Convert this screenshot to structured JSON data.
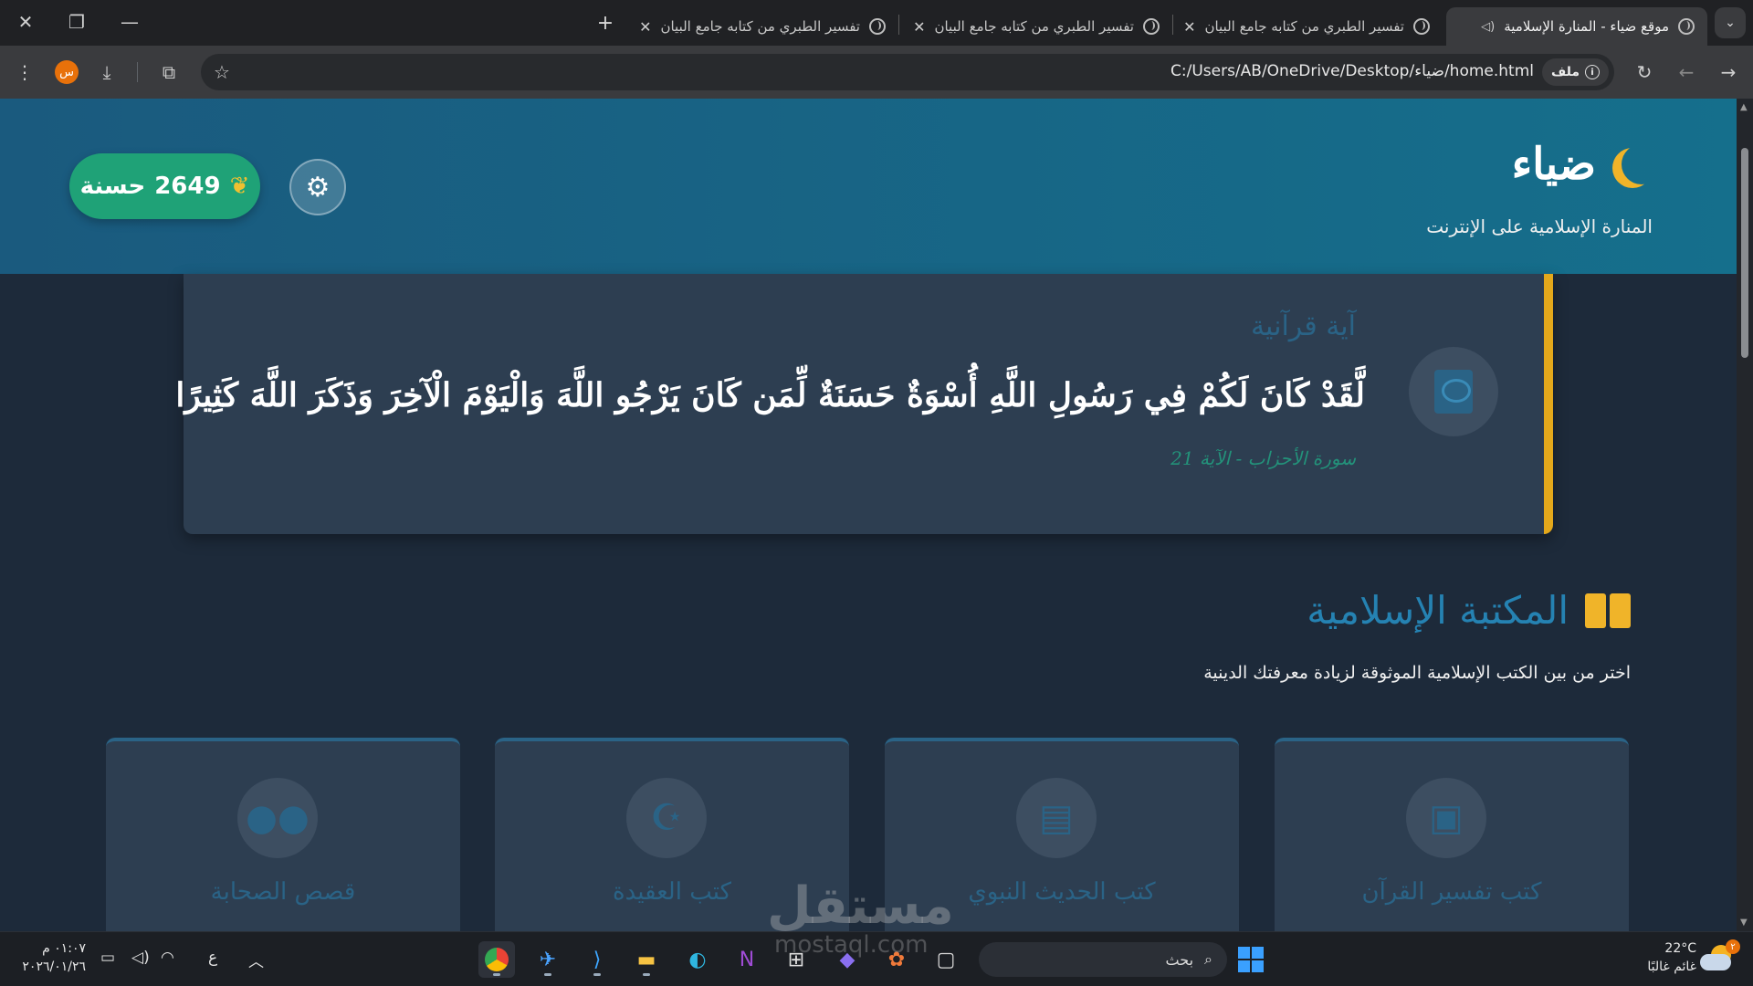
{
  "browser": {
    "tabs": [
      {
        "title": "موقع ضياء - المنارة الإسلامية",
        "active": true
      },
      {
        "title": "تفسير الطبري من كتابه جامع البيان",
        "active": false
      },
      {
        "title": "تفسير الطبري من كتابه جامع البيان",
        "active": false
      },
      {
        "title": "تفسير الطبري من كتابه جامع البيان",
        "active": false
      }
    ],
    "new_tab": "+",
    "address": {
      "chip_label": "ملف",
      "url": "C:/Users/AB/OneDrive/Desktop/ضياء/home.html"
    },
    "profile_initial": "س"
  },
  "header": {
    "site_name": "ضياء",
    "tagline": "المنارة الإسلامية على الإنترنت",
    "points": {
      "value": "2649",
      "label": "حسنة"
    }
  },
  "verse": {
    "label": "آية قرآنية",
    "text": "لَّقَدْ كَانَ لَكُمْ فِي رَسُولِ اللَّهِ أُسْوَةٌ حَسَنَةٌ لِّمَن كَانَ يَرْجُو اللَّهَ وَالْيَوْمَ الْآخِرَ وَذَكَرَ اللَّهَ كَثِيرًا",
    "reference": "سورة الأحزاب - الآية 21"
  },
  "library": {
    "title": "المكتبة الإسلامية",
    "subtitle": "اختر من بين الكتب الإسلامية الموثوقة لزيادة معرفتك الدينية",
    "categories": [
      {
        "title": "كتب تفسير القرآن",
        "icon": "quran-icon"
      },
      {
        "title": "كتب الحديث النبوي",
        "icon": "book-icon"
      },
      {
        "title": "كتب العقيدة",
        "icon": "crescent-icon"
      },
      {
        "title": "قصص الصحابة",
        "icon": "users-icon"
      }
    ]
  },
  "taskbar": {
    "time": "٠١:٠٧ م",
    "date": "٢٠٢٦/٠١/٢٦",
    "lang": "ع",
    "search_placeholder": "بحث",
    "weather": {
      "temp": "22°C",
      "desc": "غائم غالبًا"
    },
    "notification_count": "٢"
  },
  "watermark": {
    "text": "مستقل",
    "sub": "mostaql.com"
  },
  "colors": {
    "header": "#156f8c",
    "accent_gold": "#f0b429",
    "points_green": "#1fa277",
    "card_bg": "#2d3e51",
    "page_bg": "#1d2a3a"
  }
}
